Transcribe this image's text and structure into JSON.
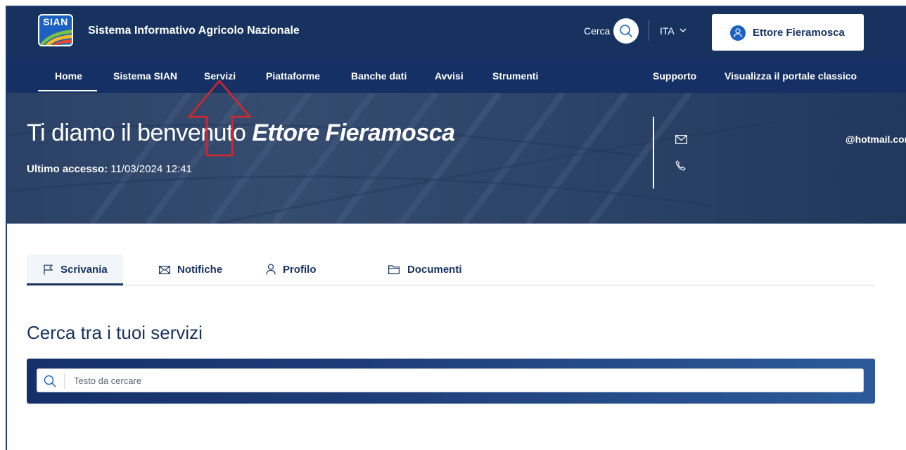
{
  "header": {
    "logo_text": "SIAN",
    "site_title": "Sistema Informativo Agricolo Nazionale",
    "search_label": "Cerca",
    "language": "ITA",
    "user_name": "Ettore Fieramosca"
  },
  "nav": {
    "items": [
      "Home",
      "Sistema SIAN",
      "Servizi",
      "Piattaforme",
      "Banche dati",
      "Avvisi",
      "Strumenti"
    ],
    "right_items": [
      "Supporto",
      "Visualizza il portale classico"
    ],
    "active": "Home"
  },
  "hero": {
    "welcome": "Ti diamo il benvenuto",
    "name": "Ettore Fieramosca",
    "last_access_label": "Ultimo accesso:",
    "last_access_value": "11/03/2024 12:41",
    "email": "@hotmail.com"
  },
  "tabs": [
    {
      "label": "Scrivania",
      "icon": "flag-icon",
      "active": true
    },
    {
      "label": "Notifiche",
      "icon": "mail-icon",
      "active": false
    },
    {
      "label": "Profilo",
      "icon": "user-icon",
      "active": false
    },
    {
      "label": "Documenti",
      "icon": "folder-icon",
      "active": false
    }
  ],
  "services": {
    "title": "Cerca tra i tuoi servizi",
    "search_placeholder": "Testo da cercare"
  },
  "colors": {
    "header_bg": "#17325f",
    "nav_bg": "#153064",
    "accent": "#1b61c1",
    "annotation_arrow": "#d9262b"
  }
}
